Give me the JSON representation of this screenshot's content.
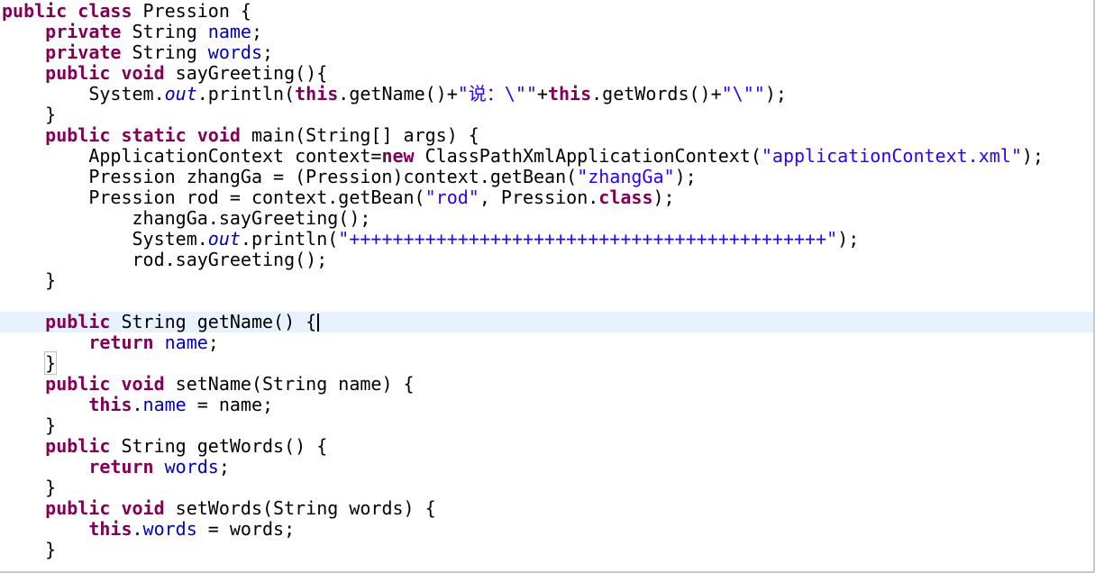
{
  "code_lines": [
    [
      {
        "t": "public",
        "c": "kw"
      },
      {
        "t": " "
      },
      {
        "t": "class",
        "c": "kw"
      },
      {
        "t": " Pression {"
      }
    ],
    [
      {
        "t": "    "
      },
      {
        "t": "private",
        "c": "kw"
      },
      {
        "t": " String "
      },
      {
        "t": "name",
        "c": "fld"
      },
      {
        "t": ";"
      }
    ],
    [
      {
        "t": "    "
      },
      {
        "t": "private",
        "c": "kw"
      },
      {
        "t": " String "
      },
      {
        "t": "words",
        "c": "fld"
      },
      {
        "t": ";"
      }
    ],
    [
      {
        "t": "    "
      },
      {
        "t": "public",
        "c": "kw"
      },
      {
        "t": " "
      },
      {
        "t": "void",
        "c": "kw"
      },
      {
        "t": " sayGreeting(){"
      }
    ],
    [
      {
        "t": "        System."
      },
      {
        "t": "out",
        "c": "static"
      },
      {
        "t": ".println("
      },
      {
        "t": "this",
        "c": "kw"
      },
      {
        "t": ".getName()+"
      },
      {
        "t": "\"说：\\\"\"",
        "c": "str"
      },
      {
        "t": "+"
      },
      {
        "t": "this",
        "c": "kw"
      },
      {
        "t": ".getWords()+"
      },
      {
        "t": "\"\\\"\"",
        "c": "str"
      },
      {
        "t": ");"
      }
    ],
    [
      {
        "t": "    }"
      }
    ],
    [
      {
        "t": "    "
      },
      {
        "t": "public",
        "c": "kw"
      },
      {
        "t": " "
      },
      {
        "t": "static",
        "c": "kw"
      },
      {
        "t": " "
      },
      {
        "t": "void",
        "c": "kw"
      },
      {
        "t": " main(String[] args) {"
      }
    ],
    [
      {
        "t": "        ApplicationContext context="
      },
      {
        "t": "new",
        "c": "kw"
      },
      {
        "t": " ClassPathXmlApplicationContext("
      },
      {
        "t": "\"applicationContext.xml\"",
        "c": "str"
      },
      {
        "t": ");"
      }
    ],
    [
      {
        "t": "        Pression zhangGa = (Pression)context.getBean("
      },
      {
        "t": "\"zhangGa\"",
        "c": "str"
      },
      {
        "t": ");"
      }
    ],
    [
      {
        "t": "        Pression rod = context.getBean("
      },
      {
        "t": "\"rod\"",
        "c": "str"
      },
      {
        "t": ", Pression."
      },
      {
        "t": "class",
        "c": "kw"
      },
      {
        "t": ");"
      }
    ],
    [
      {
        "t": "            zhangGa.sayGreeting();"
      }
    ],
    [
      {
        "t": "            System."
      },
      {
        "t": "out",
        "c": "static"
      },
      {
        "t": ".println("
      },
      {
        "t": "\"++++++++++++++++++++++++++++++++++++++++++++\"",
        "c": "str"
      },
      {
        "t": ");"
      }
    ],
    [
      {
        "t": "            rod.sayGreeting();"
      }
    ],
    [
      {
        "t": "    }"
      }
    ],
    [
      {
        "t": ""
      }
    ],
    [
      {
        "t": "    "
      },
      {
        "t": "public",
        "c": "kw"
      },
      {
        "t": " String getName() {"
      }
    ],
    [
      {
        "t": "        "
      },
      {
        "t": "return",
        "c": "kw"
      },
      {
        "t": " "
      },
      {
        "t": "name",
        "c": "fld"
      },
      {
        "t": ";"
      }
    ],
    [
      {
        "t": "    "
      },
      {
        "t": "}",
        "c": "brace-match"
      }
    ],
    [
      {
        "t": "    "
      },
      {
        "t": "public",
        "c": "kw"
      },
      {
        "t": " "
      },
      {
        "t": "void",
        "c": "kw"
      },
      {
        "t": " setName(String name) {"
      }
    ],
    [
      {
        "t": "        "
      },
      {
        "t": "this",
        "c": "kw"
      },
      {
        "t": "."
      },
      {
        "t": "name",
        "c": "fld"
      },
      {
        "t": " = name;"
      }
    ],
    [
      {
        "t": "    }"
      }
    ],
    [
      {
        "t": "    "
      },
      {
        "t": "public",
        "c": "kw"
      },
      {
        "t": " String getWords() {"
      }
    ],
    [
      {
        "t": "        "
      },
      {
        "t": "return",
        "c": "kw"
      },
      {
        "t": " "
      },
      {
        "t": "words",
        "c": "fld"
      },
      {
        "t": ";"
      }
    ],
    [
      {
        "t": "    }"
      }
    ],
    [
      {
        "t": "    "
      },
      {
        "t": "public",
        "c": "kw"
      },
      {
        "t": " "
      },
      {
        "t": "void",
        "c": "kw"
      },
      {
        "t": " setWords(String words) {"
      }
    ],
    [
      {
        "t": "        "
      },
      {
        "t": "this",
        "c": "kw"
      },
      {
        "t": "."
      },
      {
        "t": "words",
        "c": "fld"
      },
      {
        "t": " = words;"
      }
    ],
    [
      {
        "t": "    }"
      }
    ]
  ],
  "current_line": 15,
  "colors": {
    "keyword": "#7f0055",
    "field": "#0000c0",
    "string": "#2a00ff",
    "current_line_highlight": "#e8f2fe"
  }
}
